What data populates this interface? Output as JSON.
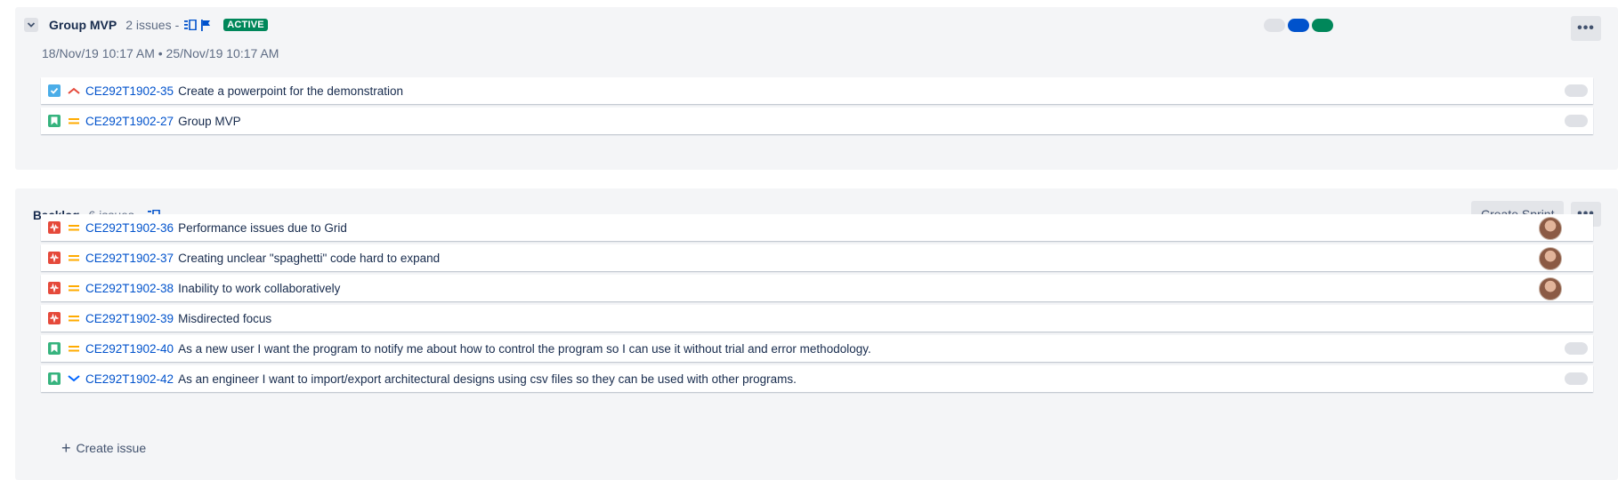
{
  "sprint": {
    "title": "Group MVP",
    "issue_count": "2 issues",
    "separator": "-",
    "status": "ACTIVE",
    "dates": "18/Nov/19 10:17 AM  •  25/Nov/19 10:17 AM",
    "status_colors": [
      "#dfe1e6",
      "#0052cc",
      "#00875a"
    ],
    "more_label": "•••",
    "issues": [
      {
        "type": "subtask",
        "priority": "high",
        "key": "CE292T1902-35",
        "summary": "Create a powerpoint for the demonstration",
        "estimate": true
      },
      {
        "type": "story",
        "priority": "medium",
        "key": "CE292T1902-27",
        "summary": "Group MVP",
        "estimate": true
      }
    ]
  },
  "backlog": {
    "title": "Backlog",
    "issue_count": "6 issues",
    "separator": "-",
    "create_sprint_label": "Create Sprint",
    "more_label": "•••",
    "create_issue_label": "Create issue",
    "issues": [
      {
        "type": "bug",
        "priority": "medium",
        "key": "CE292T1902-36",
        "summary": "Performance issues due to Grid",
        "assignee": true
      },
      {
        "type": "bug",
        "priority": "medium",
        "key": "CE292T1902-37",
        "summary": "Creating unclear \"spaghetti\" code hard to expand",
        "assignee": true
      },
      {
        "type": "bug",
        "priority": "medium",
        "key": "CE292T1902-38",
        "summary": "Inability to work collaboratively",
        "assignee": true
      },
      {
        "type": "bug",
        "priority": "medium",
        "key": "CE292T1902-39",
        "summary": "Misdirected focus"
      },
      {
        "type": "story",
        "priority": "medium",
        "key": "CE292T1902-40",
        "summary": "As a new user I want the program to notify me about how to control the program so I can use it without trial and error methodology.",
        "estimate": true
      },
      {
        "type": "story",
        "priority": "low",
        "key": "CE292T1902-42",
        "summary": "As an engineer I want to import/export architectural designs using csv files so they can be used with other programs.",
        "estimate": true
      }
    ]
  },
  "icon_colors": {
    "link": "#0052cc",
    "subtask": "#4bade8",
    "story": "#36b37e",
    "bug": "#e5493a",
    "prio_high": "#e5493a",
    "prio_medium": "#ffab00",
    "prio_low": "#0065ff"
  }
}
